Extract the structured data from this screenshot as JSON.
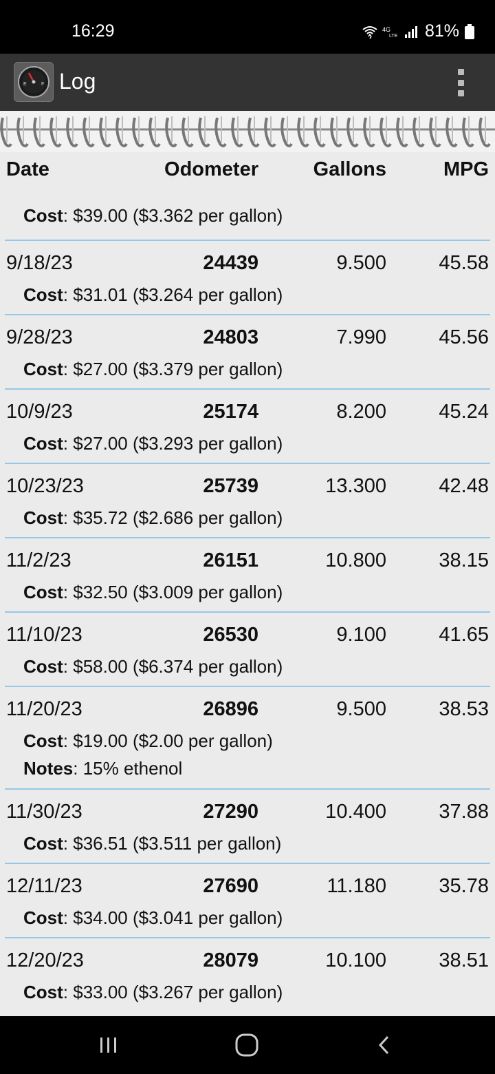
{
  "status": {
    "time": "16:29",
    "battery": "81%"
  },
  "app": {
    "title": "Log"
  },
  "columns": {
    "date": "Date",
    "odometer": "Odometer",
    "gallons": "Gallons",
    "mpg": "MPG"
  },
  "cost_label": "Cost",
  "notes_label": "Notes",
  "top_cost": ": $39.00 ($3.362 per gallon)",
  "entries": [
    {
      "date": "9/18/23",
      "odometer": "24439",
      "gallons": "9.500",
      "mpg": "45.58",
      "cost": ": $31.01 ($3.264 per gallon)"
    },
    {
      "date": "9/28/23",
      "odometer": "24803",
      "gallons": "7.990",
      "mpg": "45.56",
      "cost": ": $27.00 ($3.379 per gallon)"
    },
    {
      "date": "10/9/23",
      "odometer": "25174",
      "gallons": "8.200",
      "mpg": "45.24",
      "cost": ": $27.00 ($3.293 per gallon)"
    },
    {
      "date": "10/23/23",
      "odometer": "25739",
      "gallons": "13.300",
      "mpg": "42.48",
      "cost": ": $35.72 ($2.686 per gallon)"
    },
    {
      "date": "11/2/23",
      "odometer": "26151",
      "gallons": "10.800",
      "mpg": "38.15",
      "cost": ": $32.50 ($3.009 per gallon)"
    },
    {
      "date": "11/10/23",
      "odometer": "26530",
      "gallons": "9.100",
      "mpg": "41.65",
      "cost": ": $58.00 ($6.374 per gallon)"
    },
    {
      "date": "11/20/23",
      "odometer": "26896",
      "gallons": "9.500",
      "mpg": "38.53",
      "cost": ": $19.00 ($2.00 per gallon)",
      "notes": ": 15% ethenol"
    },
    {
      "date": "11/30/23",
      "odometer": "27290",
      "gallons": "10.400",
      "mpg": "37.88",
      "cost": ": $36.51 ($3.511 per gallon)"
    },
    {
      "date": "12/11/23",
      "odometer": "27690",
      "gallons": "11.180",
      "mpg": "35.78",
      "cost": ": $34.00 ($3.041 per gallon)"
    },
    {
      "date": "12/20/23",
      "odometer": "28079",
      "gallons": "10.100",
      "mpg": "38.51",
      "cost": ": $33.00 ($3.267 per gallon)"
    }
  ],
  "icons": {
    "app": "fuel-gauge-icon",
    "overflow": "more-vert-icon",
    "nav_recent": "recent-apps-icon",
    "nav_home": "home-icon",
    "nav_back": "back-icon"
  },
  "colors": {
    "divider": "#96c7e6",
    "app_bar": "#333333",
    "background": "#ebebeb"
  }
}
